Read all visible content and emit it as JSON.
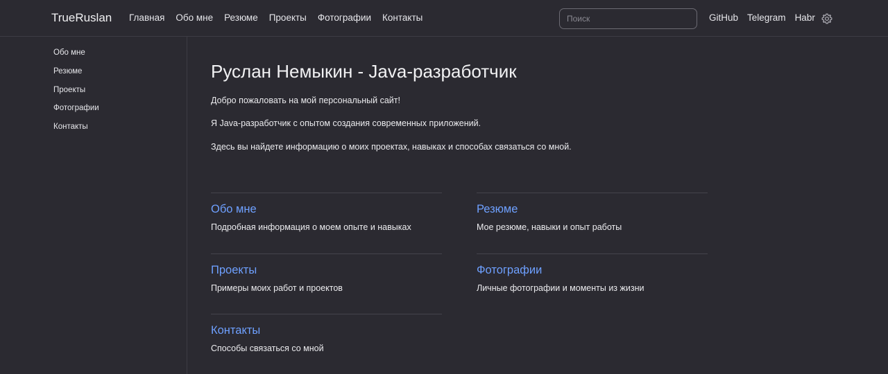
{
  "header": {
    "brand": "TrueRuslan",
    "nav": [
      "Главная",
      "Обо мне",
      "Резюме",
      "Проекты",
      "Фотографии",
      "Контакты"
    ],
    "search_placeholder": "Поиск",
    "external_links": [
      "GitHub",
      "Telegram",
      "Habr"
    ],
    "settings_icon": "gear-icon"
  },
  "sidebar": {
    "items": [
      "Обо мне",
      "Резюме",
      "Проекты",
      "Фотографии",
      "Контакты"
    ]
  },
  "main": {
    "title": "Руслан Немыкин - Java-разработчик",
    "paragraphs": [
      "Добро пожаловать на мой персональный сайт!",
      "Я Java-разработчик с опытом создания современных приложений.",
      "Здесь вы найдете информацию о моих проектах, навыках и способах связаться со мной."
    ],
    "cards": [
      {
        "title": "Обо мне",
        "desc": "Подробная информация о моем опыте и навыках"
      },
      {
        "title": "Резюме",
        "desc": "Мое резюме, навыки и опыт работы"
      },
      {
        "title": "Проекты",
        "desc": "Примеры моих работ и проектов"
      },
      {
        "title": "Фотографии",
        "desc": "Личные фотографии и моменты из жизни"
      },
      {
        "title": "Контакты",
        "desc": "Способы связаться со мной"
      }
    ]
  },
  "colors": {
    "background": "#2b2a31",
    "link_accent": "#6ea0ff",
    "border": "#3d3c44"
  }
}
